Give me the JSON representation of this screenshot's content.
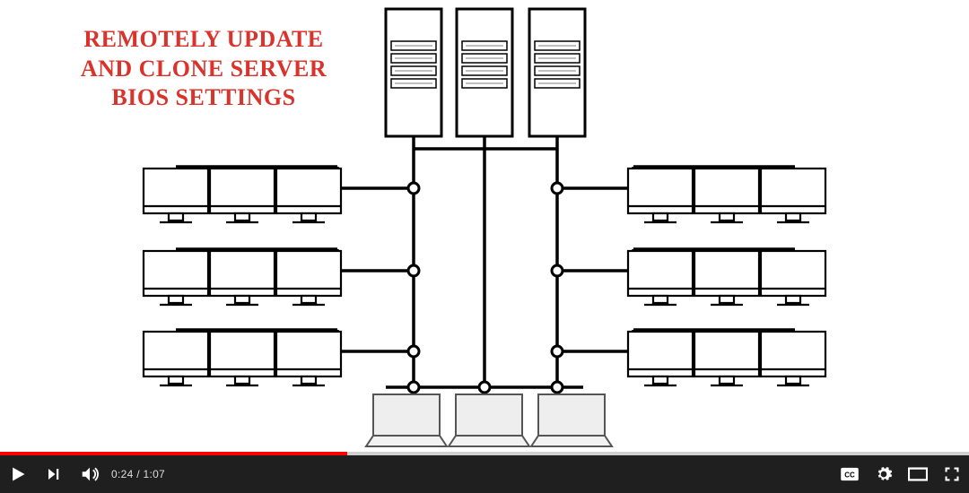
{
  "video": {
    "annotation_text": "REMOTELY UPDATE AND CLONE SERVER BIOS SETTINGS",
    "accent_color": "#d9332c"
  },
  "player": {
    "current_time": "0:24",
    "duration": "1:07",
    "time_separator": " / ",
    "progress_percent": 35.8
  },
  "icons": {
    "play": "play-icon",
    "next": "next-icon",
    "volume": "volume-icon",
    "cc": "captions-icon",
    "settings": "gear-icon",
    "theater": "theater-icon",
    "fullscreen": "fullscreen-icon"
  }
}
